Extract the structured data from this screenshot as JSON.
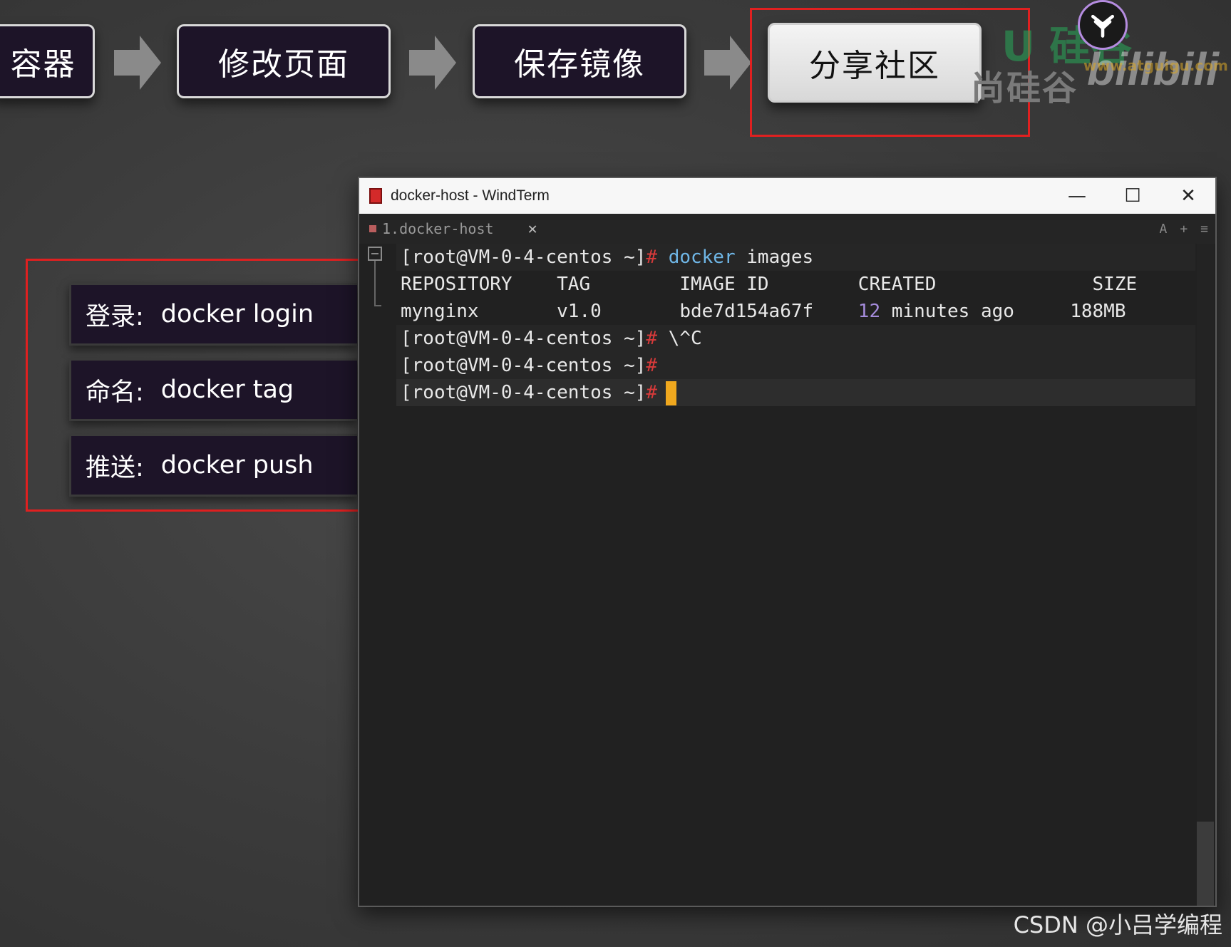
{
  "flow": {
    "steps": [
      "容器",
      "修改页面",
      "保存镜像",
      "分享社区"
    ],
    "active_step": "分享社区"
  },
  "commands": [
    {
      "key": "登录:",
      "cmd": "docker login"
    },
    {
      "key": "命名:",
      "cmd": "docker tag"
    },
    {
      "key": "推送:",
      "cmd": "docker push"
    }
  ],
  "window": {
    "title": "docker-host - WindTerm",
    "tab_label": "1.docker-host",
    "tab_close": "✕",
    "tools": [
      "A",
      "+",
      "≡"
    ],
    "controls": {
      "minimize": "—",
      "maximize": "☐",
      "close": "✕"
    }
  },
  "terminal": {
    "prompt": "[root@VM-0-4-centos ~]",
    "hash": "#",
    "cmd1_prog": "docker",
    "cmd1_args": " images",
    "header": "REPOSITORY    TAG        IMAGE ID        CREATED              SIZE",
    "row_a": "mynginx       v1.0       bde7d154a67f    ",
    "row_num": "12",
    "row_b": " minutes ago     188MB",
    "cmd2": " \\^C"
  },
  "watermarks": {
    "logo": "尚硅谷",
    "brand": "U  硅谷",
    "bili": "bilibili",
    "url": "www.atguigu.com",
    "csdn": "CSDN @小吕学编程"
  },
  "colors": {
    "highlight": "#e02020",
    "step_bg": "#1d1428",
    "cursor": "#f0a81e"
  }
}
